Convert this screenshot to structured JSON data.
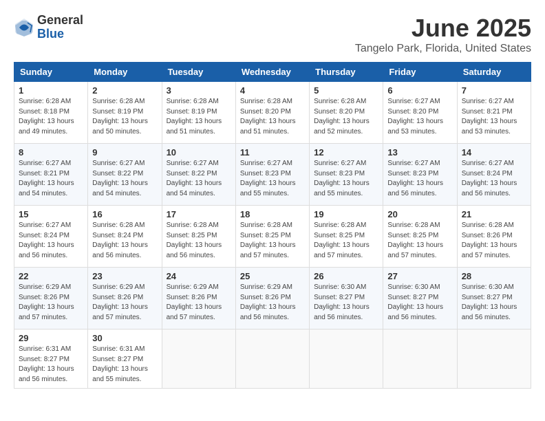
{
  "logo": {
    "general": "General",
    "blue": "Blue"
  },
  "title": "June 2025",
  "location": "Tangelo Park, Florida, United States",
  "days_of_week": [
    "Sunday",
    "Monday",
    "Tuesday",
    "Wednesday",
    "Thursday",
    "Friday",
    "Saturday"
  ],
  "weeks": [
    [
      {
        "day": "1",
        "sunrise": "6:28 AM",
        "sunset": "8:18 PM",
        "daylight": "13 hours and 49 minutes."
      },
      {
        "day": "2",
        "sunrise": "6:28 AM",
        "sunset": "8:19 PM",
        "daylight": "13 hours and 50 minutes."
      },
      {
        "day": "3",
        "sunrise": "6:28 AM",
        "sunset": "8:19 PM",
        "daylight": "13 hours and 51 minutes."
      },
      {
        "day": "4",
        "sunrise": "6:28 AM",
        "sunset": "8:20 PM",
        "daylight": "13 hours and 51 minutes."
      },
      {
        "day": "5",
        "sunrise": "6:28 AM",
        "sunset": "8:20 PM",
        "daylight": "13 hours and 52 minutes."
      },
      {
        "day": "6",
        "sunrise": "6:27 AM",
        "sunset": "8:20 PM",
        "daylight": "13 hours and 53 minutes."
      },
      {
        "day": "7",
        "sunrise": "6:27 AM",
        "sunset": "8:21 PM",
        "daylight": "13 hours and 53 minutes."
      }
    ],
    [
      {
        "day": "8",
        "sunrise": "6:27 AM",
        "sunset": "8:21 PM",
        "daylight": "13 hours and 54 minutes."
      },
      {
        "day": "9",
        "sunrise": "6:27 AM",
        "sunset": "8:22 PM",
        "daylight": "13 hours and 54 minutes."
      },
      {
        "day": "10",
        "sunrise": "6:27 AM",
        "sunset": "8:22 PM",
        "daylight": "13 hours and 54 minutes."
      },
      {
        "day": "11",
        "sunrise": "6:27 AM",
        "sunset": "8:23 PM",
        "daylight": "13 hours and 55 minutes."
      },
      {
        "day": "12",
        "sunrise": "6:27 AM",
        "sunset": "8:23 PM",
        "daylight": "13 hours and 55 minutes."
      },
      {
        "day": "13",
        "sunrise": "6:27 AM",
        "sunset": "8:23 PM",
        "daylight": "13 hours and 56 minutes."
      },
      {
        "day": "14",
        "sunrise": "6:27 AM",
        "sunset": "8:24 PM",
        "daylight": "13 hours and 56 minutes."
      }
    ],
    [
      {
        "day": "15",
        "sunrise": "6:27 AM",
        "sunset": "8:24 PM",
        "daylight": "13 hours and 56 minutes."
      },
      {
        "day": "16",
        "sunrise": "6:28 AM",
        "sunset": "8:24 PM",
        "daylight": "13 hours and 56 minutes."
      },
      {
        "day": "17",
        "sunrise": "6:28 AM",
        "sunset": "8:25 PM",
        "daylight": "13 hours and 56 minutes."
      },
      {
        "day": "18",
        "sunrise": "6:28 AM",
        "sunset": "8:25 PM",
        "daylight": "13 hours and 57 minutes."
      },
      {
        "day": "19",
        "sunrise": "6:28 AM",
        "sunset": "8:25 PM",
        "daylight": "13 hours and 57 minutes."
      },
      {
        "day": "20",
        "sunrise": "6:28 AM",
        "sunset": "8:25 PM",
        "daylight": "13 hours and 57 minutes."
      },
      {
        "day": "21",
        "sunrise": "6:28 AM",
        "sunset": "8:26 PM",
        "daylight": "13 hours and 57 minutes."
      }
    ],
    [
      {
        "day": "22",
        "sunrise": "6:29 AM",
        "sunset": "8:26 PM",
        "daylight": "13 hours and 57 minutes."
      },
      {
        "day": "23",
        "sunrise": "6:29 AM",
        "sunset": "8:26 PM",
        "daylight": "13 hours and 57 minutes."
      },
      {
        "day": "24",
        "sunrise": "6:29 AM",
        "sunset": "8:26 PM",
        "daylight": "13 hours and 57 minutes."
      },
      {
        "day": "25",
        "sunrise": "6:29 AM",
        "sunset": "8:26 PM",
        "daylight": "13 hours and 56 minutes."
      },
      {
        "day": "26",
        "sunrise": "6:30 AM",
        "sunset": "8:27 PM",
        "daylight": "13 hours and 56 minutes."
      },
      {
        "day": "27",
        "sunrise": "6:30 AM",
        "sunset": "8:27 PM",
        "daylight": "13 hours and 56 minutes."
      },
      {
        "day": "28",
        "sunrise": "6:30 AM",
        "sunset": "8:27 PM",
        "daylight": "13 hours and 56 minutes."
      }
    ],
    [
      {
        "day": "29",
        "sunrise": "6:31 AM",
        "sunset": "8:27 PM",
        "daylight": "13 hours and 56 minutes."
      },
      {
        "day": "30",
        "sunrise": "6:31 AM",
        "sunset": "8:27 PM",
        "daylight": "13 hours and 55 minutes."
      },
      null,
      null,
      null,
      null,
      null
    ]
  ],
  "labels": {
    "sunrise": "Sunrise:",
    "sunset": "Sunset:",
    "daylight": "Daylight:"
  }
}
